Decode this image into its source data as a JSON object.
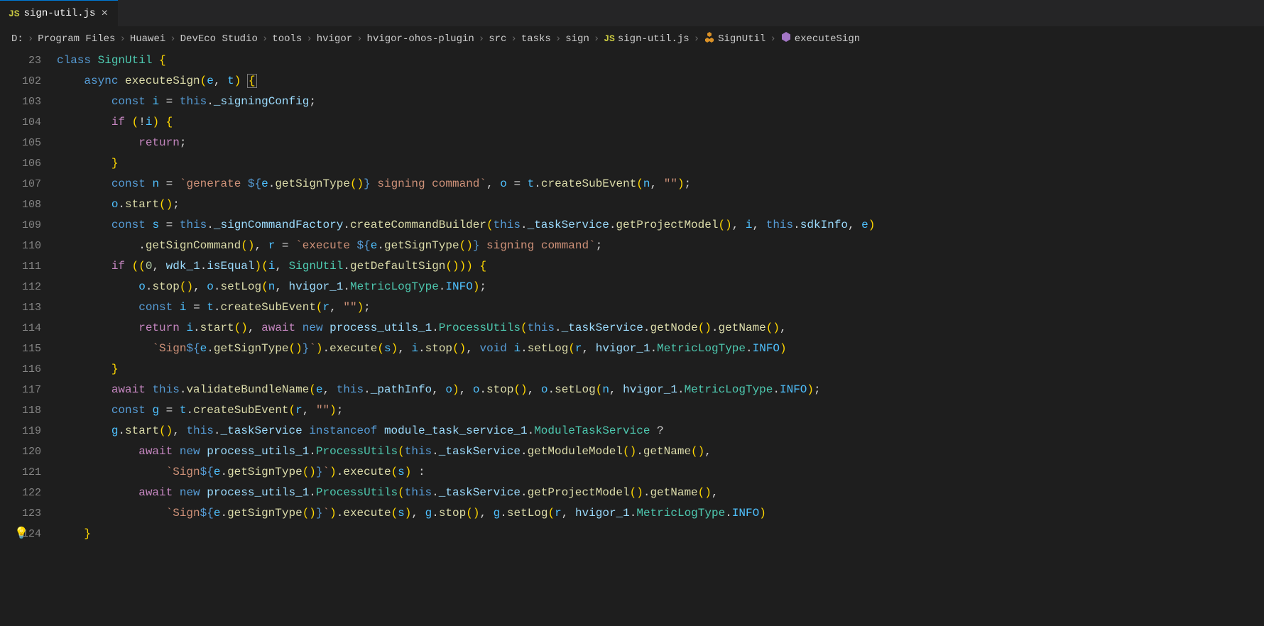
{
  "tab": {
    "icon_label": "JS",
    "filename": "sign-util.js",
    "close": "×"
  },
  "breadcrumb": {
    "parts": [
      "D:",
      "Program Files",
      "Huawei",
      "DevEco Studio",
      "tools",
      "hvigor",
      "hvigor-ohos-plugin",
      "src",
      "tasks",
      "sign"
    ],
    "file_icon": "JS",
    "file": "sign-util.js",
    "symbol_class": "SignUtil",
    "symbol_method": "executeSign",
    "sep": "›"
  },
  "editor": {
    "sticky_line_no": "23",
    "line_numbers": [
      "102",
      "103",
      "104",
      "105",
      "106",
      "107",
      "108",
      "109",
      "110",
      "111",
      "112",
      "113",
      "114",
      "115",
      "116",
      "117",
      "118",
      "119",
      "120",
      "121",
      "122",
      "123",
      "124"
    ],
    "code": {
      "l23": "class SignUtil {",
      "l102": "    async executeSign(e, t) {",
      "l103": "        const i = this._signingConfig;",
      "l104": "        if (!i) {",
      "l105": "            return;",
      "l106": "        }",
      "l107": "        const n = `generate ${e.getSignType()} signing command`, o = t.createSubEvent(n, \"\");",
      "l108": "        o.start();",
      "l109": "        const s = this._signCommandFactory.createCommandBuilder(this._taskService.getProjectModel(), i, this.sdkInfo, e)",
      "l110": "            .getSignCommand(), r = `execute ${e.getSignType()} signing command`;",
      "l111": "        if ((0, wdk_1.isEqual)(i, SignUtil.getDefaultSign())) {",
      "l112": "            o.stop(), o.setLog(n, hvigor_1.MetricLogType.INFO);",
      "l113": "            const i = t.createSubEvent(r, \"\");",
      "l114": "            return i.start(), await new process_utils_1.ProcessUtils(this._taskService.getNode().getName(),",
      "l115": "              `Sign${e.getSignType()}`).execute(s), i.stop(), void i.setLog(r, hvigor_1.MetricLogType.INFO)",
      "l116": "        }",
      "l117": "        await this.validateBundleName(e, this._pathInfo, o), o.stop(), o.setLog(n, hvigor_1.MetricLogType.INFO);",
      "l118": "        const g = t.createSubEvent(r, \"\");",
      "l119": "        g.start(), this._taskService instanceof module_task_service_1.ModuleTaskService ?",
      "l120": "            await new process_utils_1.ProcessUtils(this._taskService.getModuleModel().getName(),",
      "l121": "                `Sign${e.getSignType()}`).execute(s) :",
      "l122": "            await new process_utils_1.ProcessUtils(this._taskService.getProjectModel().getName(),",
      "l123": "                `Sign${e.getSignType()}`).execute(s), g.stop(), g.setLog(r, hvigor_1.MetricLogType.INFO)",
      "l124": "    }"
    }
  }
}
